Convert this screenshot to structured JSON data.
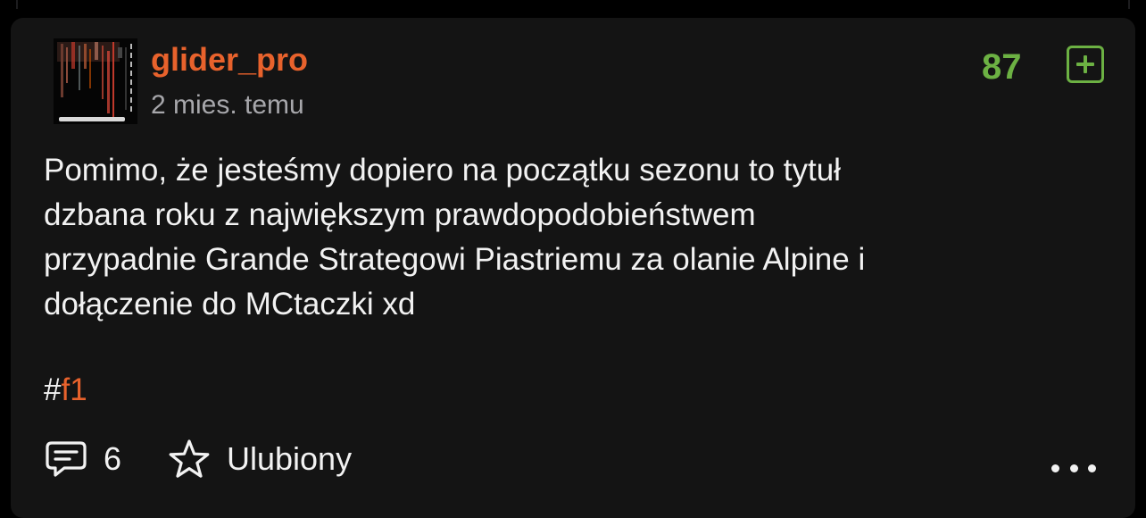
{
  "post": {
    "author": "glider_pro",
    "time_ago": "2 mies. temu",
    "score": "87",
    "body": "Pomimo, że jesteśmy dopiero na początku sezonu to tytuł\ndzbana roku z największym prawdopodobieństwem\nprzypadnie Grande Strategowi Piastriemu za olanie Alpine i\ndołączenie do MCtaczki xd",
    "hashtag_symbol": "#",
    "hashtag": "f1",
    "comment_count": "6",
    "favorite_label": "Ulubiony"
  },
  "icons": {
    "vote": "plus-square-icon",
    "comments": "speech-bubble-icon",
    "favorite": "star-outline-icon",
    "more": "more-dots-icon"
  },
  "colors": {
    "background": "#000000",
    "card": "#141414",
    "accent_orange": "#e8622c",
    "score_green": "#6cb143",
    "text": "#f2f2f2",
    "muted": "#a7a7ab"
  }
}
